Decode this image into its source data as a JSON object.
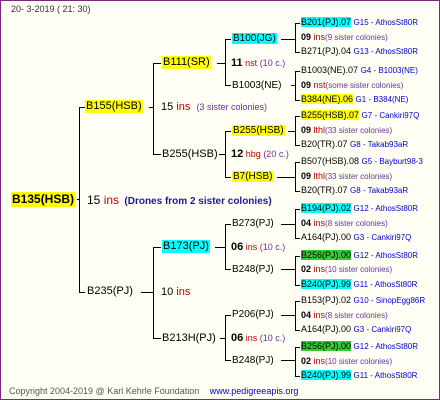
{
  "header": {
    "date": "20-  3-2019 ( 21: 30)"
  },
  "footer": {
    "copyright": "Copyright 2004-2019 @ Karl Kehrle Foundation",
    "url": "www.pedigreeapis.org"
  },
  "root": {
    "id": "B135(HSB)",
    "gen": "15",
    "unit": "ins",
    "note": "(Drones from 2 sister colonies)"
  },
  "gen1": [
    {
      "id": "B155(HSB)",
      "gen": "15",
      "unit": "ins",
      "note": "(3 sister colonies)"
    },
    {
      "id": "B235(PJ)",
      "gen": "10",
      "unit": "ins"
    }
  ],
  "gen2": [
    {
      "id": "B111(SR)",
      "gen": "11",
      "unit": "nst",
      "note": "(10 c.)"
    },
    {
      "id": "B255(HSB)",
      "gen": "12",
      "unit": "hbg",
      "note": "(20 c.)"
    },
    {
      "id": "B173(PJ)",
      "gen": "06",
      "unit": "ins",
      "note": "(10 c.)"
    },
    {
      "id": "B213H(PJ)",
      "gen": "06",
      "unit": "ins",
      "note": "(10 c.)"
    }
  ],
  "gen3": [
    {
      "id": "B100(JG)"
    },
    {
      "id": "B1003(NE)"
    },
    {
      "id": "B255(HSB)"
    },
    {
      "id": "B7(HSB)"
    },
    {
      "id": "B273(PJ)"
    },
    {
      "id": "B248(PJ)"
    },
    {
      "id": "P206(PJ)"
    },
    {
      "id": "B248(PJ)"
    }
  ],
  "gen4": [
    {
      "top": "B201(PJ).07",
      "top_ref": "G15 - AthosSt80R",
      "gen": "09",
      "unit": "ins",
      "note": "(9 sister colonies)",
      "bot": "B271(PJ).04",
      "bot_ref": "G13 - AthosSt80R"
    },
    {
      "top": "B1003(NE).07",
      "top_ref": "G4 - B1003(NE)",
      "gen": "09",
      "unit": "nst",
      "note": "(some sister colonies)",
      "bot": "B384(NE).06",
      "bot_ref": "G1 - B384(NE)"
    },
    {
      "top": "B255(HSB).07",
      "top_ref": "G7 - Cankiri97Q",
      "gen": "09",
      "unit": "lthl",
      "note": "(33 sister colonies)",
      "bot": "B20(TR).07",
      "bot_ref": "G8 - Takab93aR"
    },
    {
      "top": "B507(HSB).08",
      "top_ref": "G5 - Bayburt98-3",
      "gen": "09",
      "unit": "lthl",
      "note": "(33 sister colonies)",
      "bot": "B20(TR).07",
      "bot_ref": "G8 - Takab93aR"
    },
    {
      "top": "B194(PJ).02",
      "top_ref": "G12 - AthosSt80R",
      "gen": "04",
      "unit": "ins",
      "note": "(8 sister colonies)",
      "bot": "A164(PJ).00",
      "bot_ref": "G3 - Cankiri97Q"
    },
    {
      "top": "B256(PJ).00",
      "top_ref": "G12 - AthosSt80R",
      "gen": "02",
      "unit": "ins",
      "note": "(10 sister colonies)",
      "bot": "B240(PJ).99",
      "bot_ref": "G11 - AthosSt80R"
    },
    {
      "top": "B153(PJ).02",
      "top_ref": "G10 - SinopEgg86R",
      "gen": "04",
      "unit": "ins",
      "note": "(8 sister colonies)",
      "bot": "A164(PJ).00",
      "bot_ref": "G3 - Cankiri97Q"
    },
    {
      "top": "B256(PJ).00",
      "top_ref": "G12 - AthosSt80R",
      "gen": "02",
      "unit": "ins",
      "note": "(10 sister colonies)",
      "bot": "B240(PJ).99",
      "bot_ref": "G11 - AthosSt80R"
    }
  ],
  "colors": {
    "yellow": "#ffff00",
    "cyan": "#00ffff",
    "green": "#33cc33",
    "red": "#c00000",
    "navy": "#1a1a99"
  }
}
